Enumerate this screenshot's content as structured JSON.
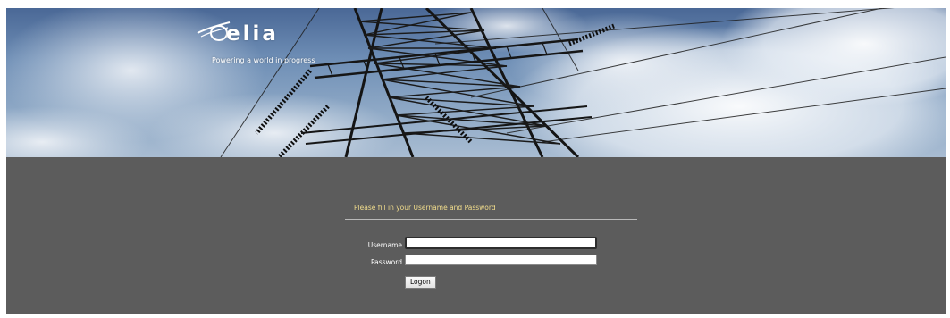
{
  "banner": {
    "logo": {
      "wordmark": "elia",
      "tagline": "Powering a world in progress"
    }
  },
  "login": {
    "instruction": "Please fill in your Username and Password",
    "username_label": "Username",
    "username_value": "",
    "password_label": "Password",
    "password_value": "",
    "logon_label": "Logon"
  },
  "colors": {
    "content_background": "#5c5c5c",
    "instruction_text": "#f2dd8c",
    "label_text": "#ffffff"
  }
}
